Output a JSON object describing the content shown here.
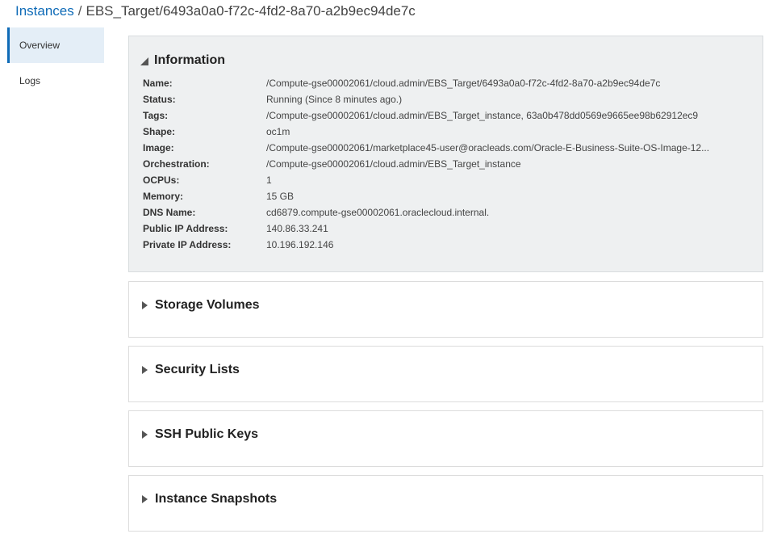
{
  "breadcrumb": {
    "root": "Instances",
    "separator": "/",
    "current": "EBS_Target/6493a0a0-f72c-4fd2-8a70-a2b9ec94de7c"
  },
  "sidebar": {
    "items": [
      {
        "label": "Overview",
        "active": true
      },
      {
        "label": "Logs",
        "active": false
      }
    ]
  },
  "information": {
    "title": "Information",
    "expanded": true,
    "fields": [
      {
        "label": "Name:",
        "value": "/Compute-gse00002061/cloud.admin/EBS_Target/6493a0a0-f72c-4fd2-8a70-a2b9ec94de7c"
      },
      {
        "label": "Status:",
        "value": "Running (Since 8 minutes ago.)"
      },
      {
        "label": "Tags:",
        "value": "/Compute-gse00002061/cloud.admin/EBS_Target_instance, 63a0b478dd0569e9665ee98b62912ec9"
      },
      {
        "label": "Shape:",
        "value": "oc1m"
      },
      {
        "label": "Image:",
        "value": "/Compute-gse00002061/marketplace45-user@oracleads.com/Oracle-E-Business-Suite-OS-Image-12..."
      },
      {
        "label": "Orchestration:",
        "value": "/Compute-gse00002061/cloud.admin/EBS_Target_instance"
      },
      {
        "label": "OCPUs:",
        "value": "1"
      },
      {
        "label": "Memory:",
        "value": "15 GB"
      },
      {
        "label": "DNS Name:",
        "value": "cd6879.compute-gse00002061.oraclecloud.internal."
      },
      {
        "label": "Public IP Address:",
        "value": "140.86.33.241"
      },
      {
        "label": "Private IP Address:",
        "value": "10.196.192.146"
      }
    ]
  },
  "sections": [
    {
      "title": "Storage Volumes",
      "expanded": false
    },
    {
      "title": "Security Lists",
      "expanded": false
    },
    {
      "title": "SSH Public Keys",
      "expanded": false
    },
    {
      "title": "Instance Snapshots",
      "expanded": false
    }
  ],
  "colors": {
    "link": "#0f6bb7",
    "active_nav_bg": "#e4eef7",
    "info_panel_bg": "#eef0f1"
  }
}
